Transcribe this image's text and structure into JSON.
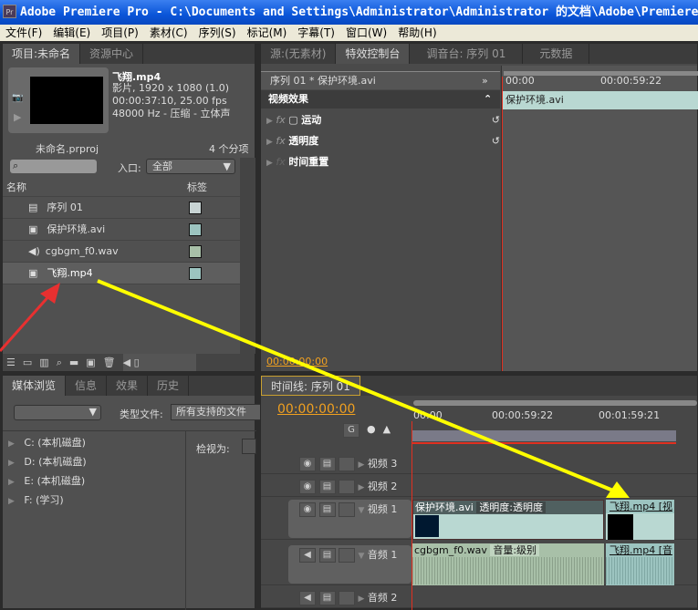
{
  "title": "Adobe Premiere Pro - C:\\Documents and Settings\\Administrator\\Administrator 的文档\\Adobe\\Premiere",
  "app_icon": "Pr",
  "menu": [
    "文件(F)",
    "编辑(E)",
    "项目(P)",
    "素材(C)",
    "序列(S)",
    "标记(M)",
    "字幕(T)",
    "窗口(W)",
    "帮助(H)"
  ],
  "project": {
    "tabs": [
      "项目:未命名",
      "资源中心"
    ],
    "preview": {
      "name": "飞翔.mp4",
      "line1": "影片, 1920 x 1080 (1.0)",
      "line2": "00:00:37:10, 25.00 fps",
      "line3": "48000 Hz - 压缩 - 立体声"
    },
    "project_file": "未命名.prproj",
    "item_count": "4 个分项",
    "search_placeholder": "",
    "entry_label": "入口:",
    "entry_value": "全部",
    "columns": [
      "名称",
      "标签"
    ],
    "items": [
      {
        "name": "序列 01",
        "icon": "sequence-icon",
        "color": "#c8d4d4"
      },
      {
        "name": "保护环境.avi",
        "icon": "movie-icon",
        "color": "#9cc4c0"
      },
      {
        "name": "cgbgm_f0.wav",
        "icon": "audio-icon",
        "color": "#a8c0a8"
      },
      {
        "name": "飞翔.mp4",
        "icon": "movie-icon",
        "color": "#9cc4c0"
      }
    ]
  },
  "effects": {
    "tabs": [
      "源:(无素材)",
      "特效控制台",
      "调音台: 序列 01",
      "元数据"
    ],
    "clip": "序列 01 * 保护环境.avi",
    "section": "视频效果",
    "items": [
      "运动",
      "透明度",
      "时间重置"
    ],
    "time_start": "00:00",
    "time_mark": "00:00:59:22",
    "clip_bar": "保护环境.avi",
    "timecode": "00:00:00:00"
  },
  "media": {
    "tabs": [
      "媒体浏览",
      "信息",
      "效果",
      "历史"
    ],
    "type_label": "类型文件:",
    "type_value": "所有支持的文件",
    "view_label": "检视为:",
    "drives": [
      "C: (本机磁盘)",
      "D: (本机磁盘)",
      "E: (本机磁盘)",
      "F: (学习)"
    ]
  },
  "timeline": {
    "tab": "时间线: 序列 01",
    "timecode": "00:00:00:00",
    "ruler": [
      "00:00",
      "00:00:59:22",
      "00:01:59:21"
    ],
    "tracks": [
      "视频 3",
      "视频 2",
      "视频 1",
      "音频 1",
      "音频 2"
    ],
    "v1_clip1": "保护环境.avi",
    "v1_clip1_fx": "透明度:透明度",
    "v1_clip2": "飞翔.mp4 [视",
    "a1_clip1": "cgbgm_f0.wav",
    "a1_clip1_fx": "音量:级别",
    "a1_clip2": "飞翔.mp4 [音"
  },
  "colors": {
    "accent": "#f0a020",
    "playhead": "#e03020",
    "arrow_yellow": "#ffff00",
    "arrow_red": "#e83030"
  }
}
